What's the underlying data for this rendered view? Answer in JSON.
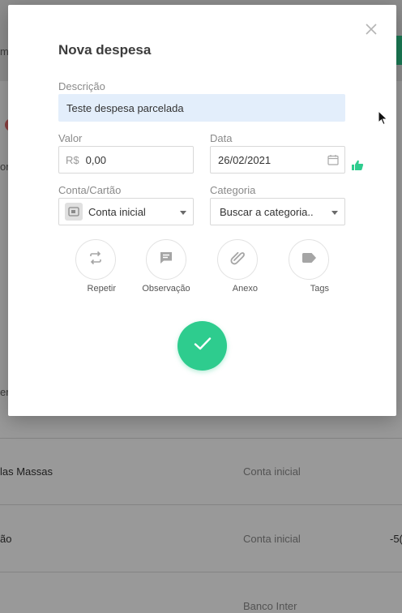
{
  "background": {
    "hint_left_top": "m",
    "hint_left_mid": "or",
    "hint_left_low": "er",
    "rows": [
      {
        "name": "las Massas",
        "account": "Conta inicial",
        "amount": ""
      },
      {
        "name": "ão",
        "account": "Conta inicial",
        "amount": "-5("
      },
      {
        "name": "",
        "account": "Banco Inter",
        "amount": ""
      }
    ],
    "accent_color": "#2ecc8e"
  },
  "modal": {
    "title": "Nova despesa",
    "close_icon": "close-icon",
    "description": {
      "label": "Descrição",
      "value": "Teste despesa parcelada"
    },
    "value": {
      "label": "Valor",
      "prefix": "R$",
      "value": "0,00"
    },
    "date": {
      "label": "Data",
      "value": "26/02/2021",
      "icon": "calendar-icon"
    },
    "account": {
      "label": "Conta/Cartão",
      "value": "Conta inicial",
      "icon": "wallet-icon"
    },
    "category": {
      "label": "Categoria",
      "placeholder": "Buscar a categoria.."
    },
    "actions": [
      {
        "label": "Repetir",
        "icon": "repeat-icon"
      },
      {
        "label": "Observação",
        "icon": "comment-icon"
      },
      {
        "label": "Anexo",
        "icon": "attachment-icon"
      },
      {
        "label": "Tags",
        "icon": "tag-icon"
      }
    ],
    "confirm_icon": "check-icon",
    "confirm_color": "#2ecc8e"
  }
}
